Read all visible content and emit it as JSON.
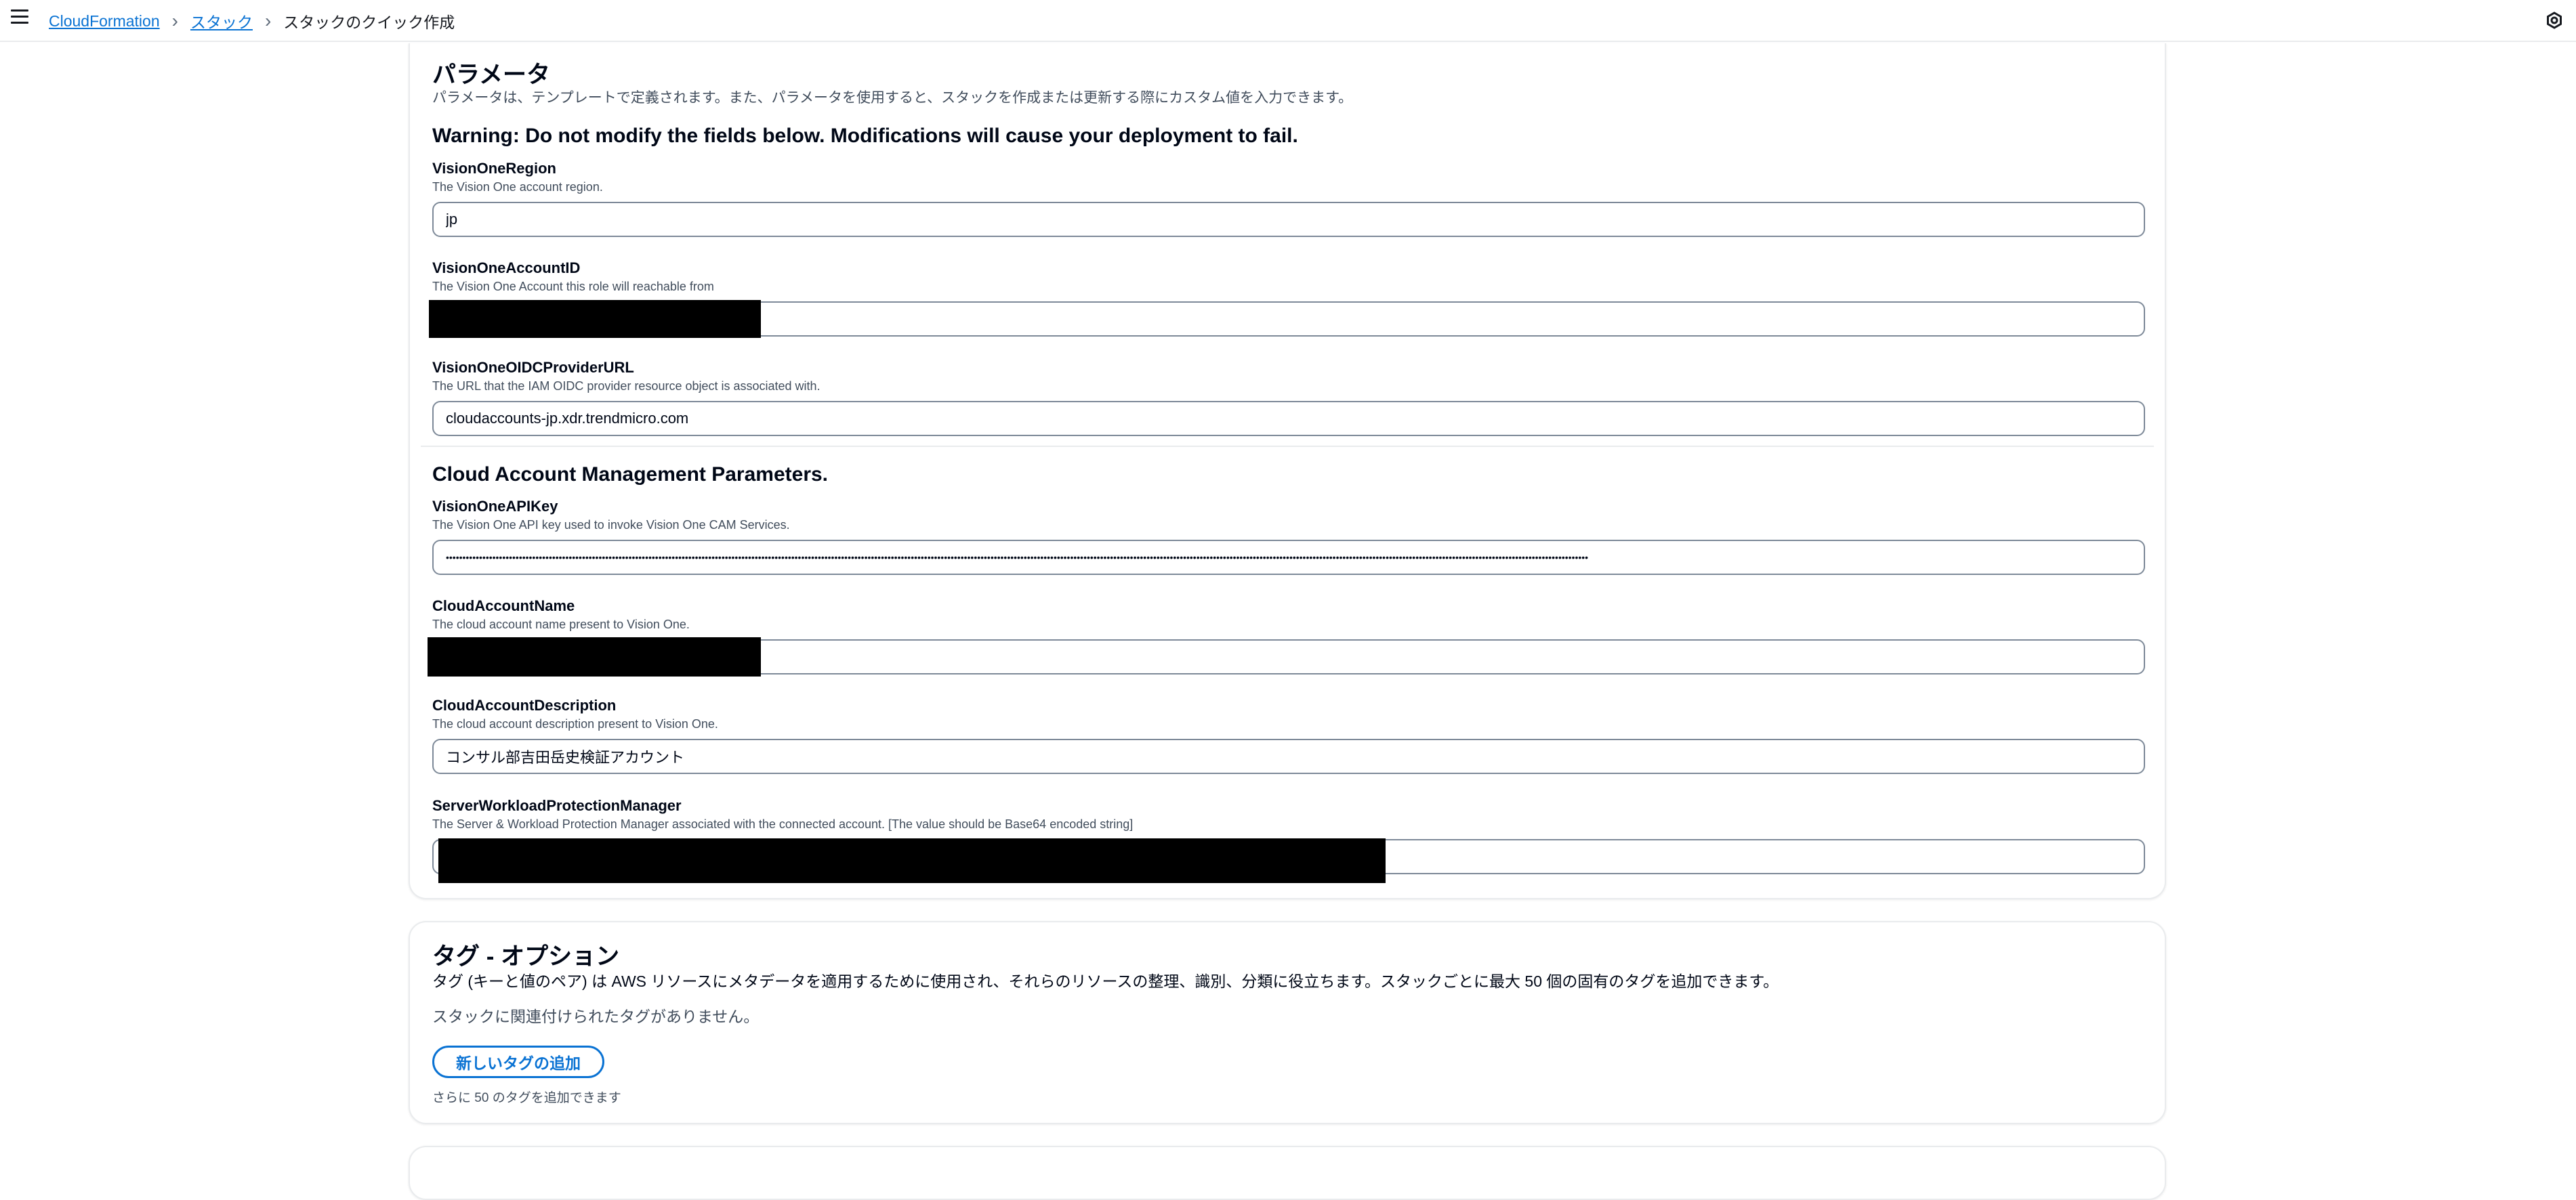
{
  "breadcrumb": {
    "items": [
      "CloudFormation",
      "スタック"
    ],
    "current": "スタックのクイック作成"
  },
  "icons": {
    "menu": "hamburger-menu-icon",
    "separator": "chevron-right-icon",
    "settings": "settings-icon"
  },
  "parameters": {
    "title": "パラメータ",
    "description": "パラメータは、テンプレートで定義されます。また、パラメータを使用すると、スタックを作成または更新する際にカスタム値を入力できます。",
    "warning": "Warning: Do not modify the fields below. Modifications will cause your deployment to fail.",
    "fields": [
      {
        "label": "VisionOneRegion",
        "description": "The Vision One account region.",
        "value": "jp"
      },
      {
        "label": "VisionOneAccountID",
        "description": "The Vision One Account this role will reachable from",
        "value": ""
      },
      {
        "label": "VisionOneOIDCProviderURL",
        "description": "The URL that the IAM OIDC provider resource object is associated with.",
        "value": "cloudaccounts-jp.xdr.trendmicro.com"
      }
    ],
    "cam_title": "Cloud Account Management Parameters.",
    "cam_fields": [
      {
        "label": "VisionOneAPIKey",
        "description": "The Vision One API key used to invoke Vision One CAM Services.",
        "value": "••••••••••••••••••••••••••••••••••••••••••••••••••••••••••••••••••••••••••••••••••••••••••••••••••••••••••••••••••••••••••••••••••••••••••••••••••••••••••••••••••••••••••••••••••••••••••••••••••••••••••••••••••••••••••••••••••••••••••••••••••••••••••••••••••••••••••••••••••••••••••••••••••••••••••••••••••••••••••••••••••••••••••••••••••••••••"
      },
      {
        "label": "CloudAccountName",
        "description": "The cloud account name present to Vision One.",
        "value": ""
      },
      {
        "label": "CloudAccountDescription",
        "description": "The cloud account description present to Vision One.",
        "value": "コンサル部吉田岳史検証アカウント"
      },
      {
        "label": "ServerWorkloadProtectionManager",
        "description": "The Server & Workload Protection Manager associated with the connected account. [The value should be Base64 encoded string]",
        "value": ""
      }
    ]
  },
  "tags": {
    "title": "タグ - オプション",
    "description": "タグ (キーと値のペア) は AWS リソースにメタデータを適用するために使用され、それらのリソースの整理、識別、分類に役立ちます。スタックごとに最大 50 個の固有のタグを追加できます。",
    "empty_message": "スタックに関連付けられたタグがありません。",
    "add_button_label": "新しいタグの追加",
    "remaining_text": "さらに 50 のタグを追加できます"
  },
  "colors": {
    "link": "#0972d3",
    "border": "#7d8998",
    "text": "#000716",
    "muted": "#414d5c"
  }
}
